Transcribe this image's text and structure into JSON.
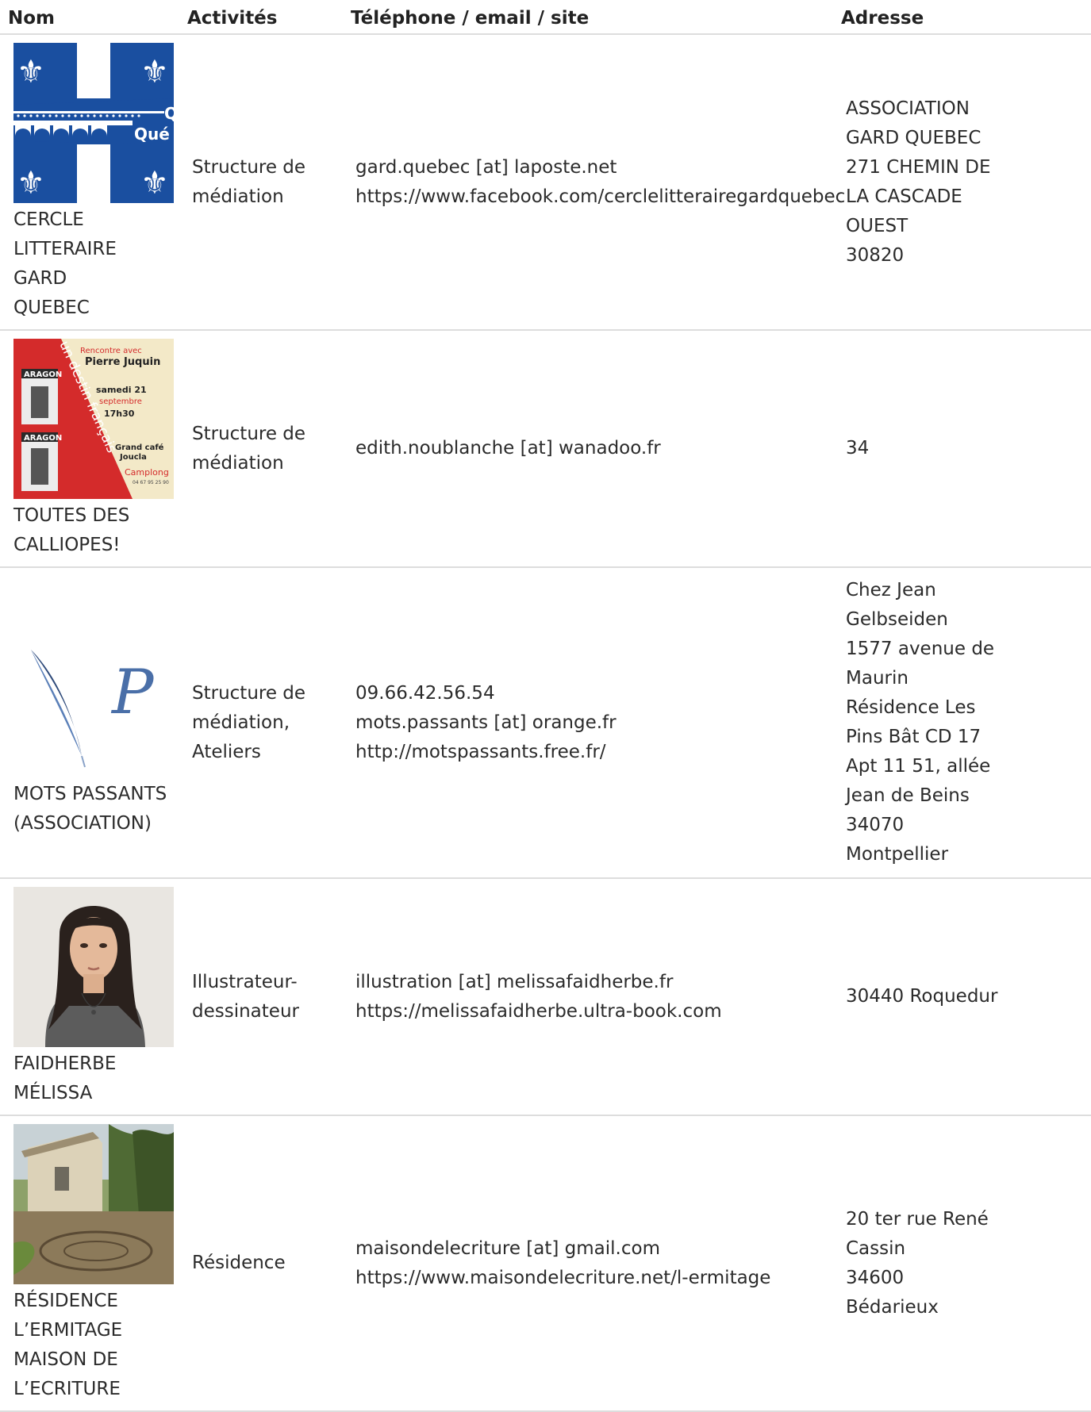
{
  "headers": {
    "nom": "Nom",
    "activites": "Activités",
    "contact": "Téléphone / email / site",
    "adresse": "Adresse"
  },
  "rows": [
    {
      "name_lines": [
        "CERCLE",
        "LITTERAIRE GARD",
        "QUEBEC"
      ],
      "image": "gard-quebec-flag-image",
      "activities": [
        "Structure de",
        "médiation"
      ],
      "contact": [
        "gard.quebec [at] laposte.net",
        "https://www.facebook.com/cerclelitterairegardquebec"
      ],
      "address": [
        "ASSOCIATION",
        "GARD QUEBEC",
        "271 CHEMIN DE",
        "LA CASCADE",
        "OUEST",
        "30820"
      ],
      "image_text": {
        "line1": "Q",
        "line2": "Qué"
      }
    },
    {
      "name_lines": [
        "TOUTES DES",
        "CALLIOPES!"
      ],
      "image": "aragon-event-poster-image",
      "activities": [
        "Structure de",
        "médiation"
      ],
      "contact": [
        "edith.noublanche [at] wanadoo.fr"
      ],
      "address": [
        "34"
      ],
      "image_text": {
        "rencontre": "Rencontre avec",
        "speaker": "Pierre Juquin",
        "date1": "samedi 21",
        "date2": "septembre",
        "time": "17h30",
        "venue1": "Grand café",
        "venue2": "Joucla",
        "town": "Camplong",
        "phone": "04 67 95 25 90",
        "book": "ARAGON",
        "banner": "un destin français"
      }
    },
    {
      "name_lines": [
        "MOTS PASSANTS",
        "(ASSOCIATION)"
      ],
      "image": "quill-logo-image",
      "activities": [
        "Structure de",
        "médiation,",
        "Ateliers"
      ],
      "contact": [
        "09.66.42.56.54",
        "mots.passants [at] orange.fr",
        "http://motspassants.free.fr/"
      ],
      "address": [
        "Chez Jean",
        "Gelbseiden",
        "1577 avenue de",
        "Maurin",
        "Résidence Les",
        "Pins Bât CD 17",
        "Apt 11 51, allée",
        "Jean de Beins",
        "34070",
        "Montpellier"
      ],
      "image_text": {
        "logo": "P"
      }
    },
    {
      "name_lines": [
        "FAIDHERBE",
        "MÉLISSA"
      ],
      "image": "portrait-photo-image",
      "activities": [
        "Illustrateur-",
        "dessinateur"
      ],
      "contact": [
        "illustration [at] melissafaidherbe.fr",
        "https://melissafaidherbe.ultra-book.com"
      ],
      "address": [
        "30440 Roquedur"
      ]
    },
    {
      "name_lines": [
        "RÉSIDENCE",
        "L’ERMITAGE",
        "MAISON DE",
        "L’ECRITURE"
      ],
      "image": "house-garden-photo-image",
      "activities": [
        "Résidence"
      ],
      "contact": [
        "maisondelecriture [at] gmail.com",
        "https://www.maisondelecriture.net/l-ermitage"
      ],
      "address": [
        "20 ter rue René",
        "Cassin",
        "34600",
        "Bédarieux"
      ]
    }
  ]
}
